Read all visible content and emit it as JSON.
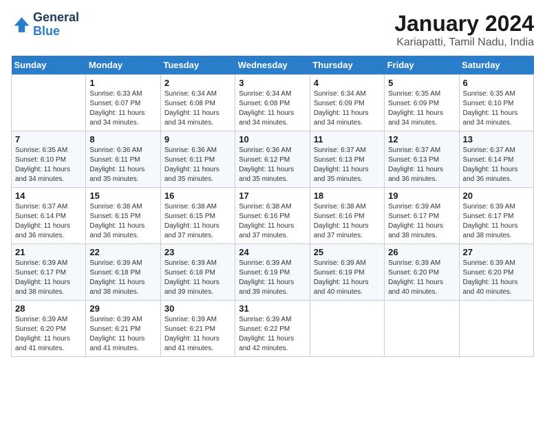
{
  "logo": {
    "line1": "General",
    "line2": "Blue"
  },
  "title": "January 2024",
  "subtitle": "Kariapatti, Tamil Nadu, India",
  "days_header": [
    "Sunday",
    "Monday",
    "Tuesday",
    "Wednesday",
    "Thursday",
    "Friday",
    "Saturday"
  ],
  "weeks": [
    [
      {
        "num": "",
        "sunrise": "",
        "sunset": "",
        "daylight": ""
      },
      {
        "num": "1",
        "sunrise": "Sunrise: 6:33 AM",
        "sunset": "Sunset: 6:07 PM",
        "daylight": "Daylight: 11 hours and 34 minutes."
      },
      {
        "num": "2",
        "sunrise": "Sunrise: 6:34 AM",
        "sunset": "Sunset: 6:08 PM",
        "daylight": "Daylight: 11 hours and 34 minutes."
      },
      {
        "num": "3",
        "sunrise": "Sunrise: 6:34 AM",
        "sunset": "Sunset: 6:08 PM",
        "daylight": "Daylight: 11 hours and 34 minutes."
      },
      {
        "num": "4",
        "sunrise": "Sunrise: 6:34 AM",
        "sunset": "Sunset: 6:09 PM",
        "daylight": "Daylight: 11 hours and 34 minutes."
      },
      {
        "num": "5",
        "sunrise": "Sunrise: 6:35 AM",
        "sunset": "Sunset: 6:09 PM",
        "daylight": "Daylight: 11 hours and 34 minutes."
      },
      {
        "num": "6",
        "sunrise": "Sunrise: 6:35 AM",
        "sunset": "Sunset: 6:10 PM",
        "daylight": "Daylight: 11 hours and 34 minutes."
      }
    ],
    [
      {
        "num": "7",
        "sunrise": "Sunrise: 6:35 AM",
        "sunset": "Sunset: 6:10 PM",
        "daylight": "Daylight: 11 hours and 34 minutes."
      },
      {
        "num": "8",
        "sunrise": "Sunrise: 6:36 AM",
        "sunset": "Sunset: 6:11 PM",
        "daylight": "Daylight: 11 hours and 35 minutes."
      },
      {
        "num": "9",
        "sunrise": "Sunrise: 6:36 AM",
        "sunset": "Sunset: 6:11 PM",
        "daylight": "Daylight: 11 hours and 35 minutes."
      },
      {
        "num": "10",
        "sunrise": "Sunrise: 6:36 AM",
        "sunset": "Sunset: 6:12 PM",
        "daylight": "Daylight: 11 hours and 35 minutes."
      },
      {
        "num": "11",
        "sunrise": "Sunrise: 6:37 AM",
        "sunset": "Sunset: 6:13 PM",
        "daylight": "Daylight: 11 hours and 35 minutes."
      },
      {
        "num": "12",
        "sunrise": "Sunrise: 6:37 AM",
        "sunset": "Sunset: 6:13 PM",
        "daylight": "Daylight: 11 hours and 36 minutes."
      },
      {
        "num": "13",
        "sunrise": "Sunrise: 6:37 AM",
        "sunset": "Sunset: 6:14 PM",
        "daylight": "Daylight: 11 hours and 36 minutes."
      }
    ],
    [
      {
        "num": "14",
        "sunrise": "Sunrise: 6:37 AM",
        "sunset": "Sunset: 6:14 PM",
        "daylight": "Daylight: 11 hours and 36 minutes."
      },
      {
        "num": "15",
        "sunrise": "Sunrise: 6:38 AM",
        "sunset": "Sunset: 6:15 PM",
        "daylight": "Daylight: 11 hours and 36 minutes."
      },
      {
        "num": "16",
        "sunrise": "Sunrise: 6:38 AM",
        "sunset": "Sunset: 6:15 PM",
        "daylight": "Daylight: 11 hours and 37 minutes."
      },
      {
        "num": "17",
        "sunrise": "Sunrise: 6:38 AM",
        "sunset": "Sunset: 6:16 PM",
        "daylight": "Daylight: 11 hours and 37 minutes."
      },
      {
        "num": "18",
        "sunrise": "Sunrise: 6:38 AM",
        "sunset": "Sunset: 6:16 PM",
        "daylight": "Daylight: 11 hours and 37 minutes."
      },
      {
        "num": "19",
        "sunrise": "Sunrise: 6:39 AM",
        "sunset": "Sunset: 6:17 PM",
        "daylight": "Daylight: 11 hours and 38 minutes."
      },
      {
        "num": "20",
        "sunrise": "Sunrise: 6:39 AM",
        "sunset": "Sunset: 6:17 PM",
        "daylight": "Daylight: 11 hours and 38 minutes."
      }
    ],
    [
      {
        "num": "21",
        "sunrise": "Sunrise: 6:39 AM",
        "sunset": "Sunset: 6:17 PM",
        "daylight": "Daylight: 11 hours and 38 minutes."
      },
      {
        "num": "22",
        "sunrise": "Sunrise: 6:39 AM",
        "sunset": "Sunset: 6:18 PM",
        "daylight": "Daylight: 11 hours and 38 minutes."
      },
      {
        "num": "23",
        "sunrise": "Sunrise: 6:39 AM",
        "sunset": "Sunset: 6:18 PM",
        "daylight": "Daylight: 11 hours and 39 minutes."
      },
      {
        "num": "24",
        "sunrise": "Sunrise: 6:39 AM",
        "sunset": "Sunset: 6:19 PM",
        "daylight": "Daylight: 11 hours and 39 minutes."
      },
      {
        "num": "25",
        "sunrise": "Sunrise: 6:39 AM",
        "sunset": "Sunset: 6:19 PM",
        "daylight": "Daylight: 11 hours and 40 minutes."
      },
      {
        "num": "26",
        "sunrise": "Sunrise: 6:39 AM",
        "sunset": "Sunset: 6:20 PM",
        "daylight": "Daylight: 11 hours and 40 minutes."
      },
      {
        "num": "27",
        "sunrise": "Sunrise: 6:39 AM",
        "sunset": "Sunset: 6:20 PM",
        "daylight": "Daylight: 11 hours and 40 minutes."
      }
    ],
    [
      {
        "num": "28",
        "sunrise": "Sunrise: 6:39 AM",
        "sunset": "Sunset: 6:20 PM",
        "daylight": "Daylight: 11 hours and 41 minutes."
      },
      {
        "num": "29",
        "sunrise": "Sunrise: 6:39 AM",
        "sunset": "Sunset: 6:21 PM",
        "daylight": "Daylight: 11 hours and 41 minutes."
      },
      {
        "num": "30",
        "sunrise": "Sunrise: 6:39 AM",
        "sunset": "Sunset: 6:21 PM",
        "daylight": "Daylight: 11 hours and 41 minutes."
      },
      {
        "num": "31",
        "sunrise": "Sunrise: 6:39 AM",
        "sunset": "Sunset: 6:22 PM",
        "daylight": "Daylight: 11 hours and 42 minutes."
      },
      {
        "num": "",
        "sunrise": "",
        "sunset": "",
        "daylight": ""
      },
      {
        "num": "",
        "sunrise": "",
        "sunset": "",
        "daylight": ""
      },
      {
        "num": "",
        "sunrise": "",
        "sunset": "",
        "daylight": ""
      }
    ]
  ]
}
